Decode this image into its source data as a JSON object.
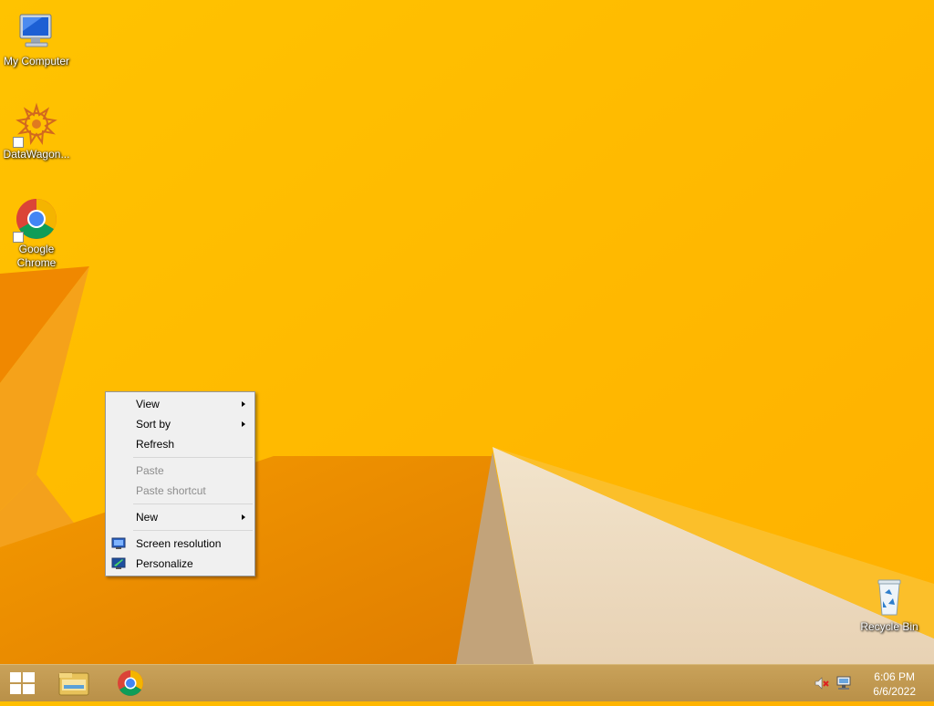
{
  "desktop": {
    "icons": [
      {
        "label": "My Computer"
      },
      {
        "label": "DataWagon..."
      },
      {
        "label": "Google Chrome"
      },
      {
        "label": "Recycle Bin"
      }
    ]
  },
  "context_menu": {
    "items": [
      {
        "label": "View",
        "submenu": true
      },
      {
        "label": "Sort by",
        "submenu": true
      },
      {
        "label": "Refresh"
      },
      {
        "label": "Paste",
        "disabled": true
      },
      {
        "label": "Paste shortcut",
        "disabled": true
      },
      {
        "label": "New",
        "submenu": true
      },
      {
        "label": "Screen resolution",
        "icon": "screen-resolution-icon"
      },
      {
        "label": "Personalize",
        "icon": "personalize-icon"
      }
    ]
  },
  "taskbar": {
    "pinned": [
      "start-button",
      "file-explorer-icon",
      "chrome-icon"
    ],
    "clock": {
      "time": "6:06 PM",
      "date": "6/6/2022"
    },
    "tray": [
      "volume-muted-icon",
      "network-icon"
    ]
  },
  "colors": {
    "wallpaper_yellow": "#ffb800",
    "wallpaper_orange": "#f08c00",
    "menu_bg": "#f0f0f0"
  }
}
